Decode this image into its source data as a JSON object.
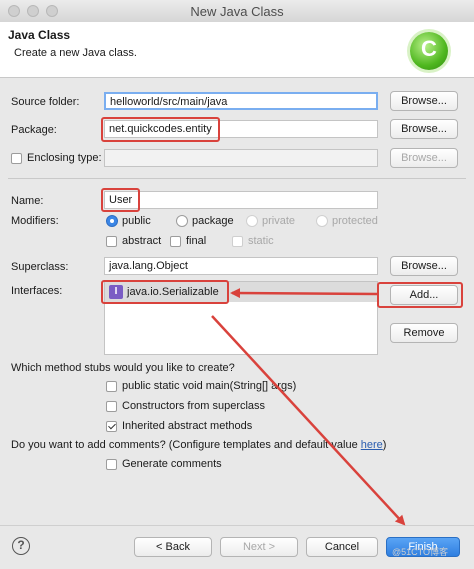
{
  "window": {
    "title": "New Java Class"
  },
  "header": {
    "title": "Java Class",
    "subtitle": "Create a new Java class.",
    "logo_letter": "C"
  },
  "source_folder": {
    "label": "Source folder:",
    "value": "helloworld/src/main/java",
    "browse": "Browse..."
  },
  "package": {
    "label": "Package:",
    "value": "net.quickcodes.entity",
    "browse": "Browse..."
  },
  "enclosing": {
    "label": "Enclosing type:",
    "value": "",
    "browse": "Browse..."
  },
  "name": {
    "label": "Name:",
    "value": "User"
  },
  "modifiers": {
    "label": "Modifiers:",
    "access": [
      "public",
      "package",
      "private",
      "protected"
    ],
    "other": [
      "abstract",
      "final",
      "static"
    ]
  },
  "superclass": {
    "label": "Superclass:",
    "value": "java.lang.Object",
    "browse": "Browse..."
  },
  "interfaces": {
    "label": "Interfaces:",
    "items": [
      "java.io.Serializable"
    ],
    "add": "Add...",
    "remove": "Remove",
    "icon_letter": "I"
  },
  "stubs": {
    "question": "Which method stubs would you like to create?",
    "options": [
      "public static void main(String[] args)",
      "Constructors from superclass",
      "Inherited abstract methods"
    ]
  },
  "comments": {
    "question": "Do you want to add comments? (Configure templates and default value ",
    "link": "here",
    "suffix": ")",
    "option": "Generate comments"
  },
  "footer": {
    "help": "?",
    "back": "< Back",
    "next": "Next >",
    "cancel": "Cancel",
    "finish": "Finish"
  },
  "watermark": "@51CTO博客",
  "colors": {
    "highlight": "#d9423c",
    "accent": "#3b86e6",
    "logo": "#4fb71f"
  }
}
